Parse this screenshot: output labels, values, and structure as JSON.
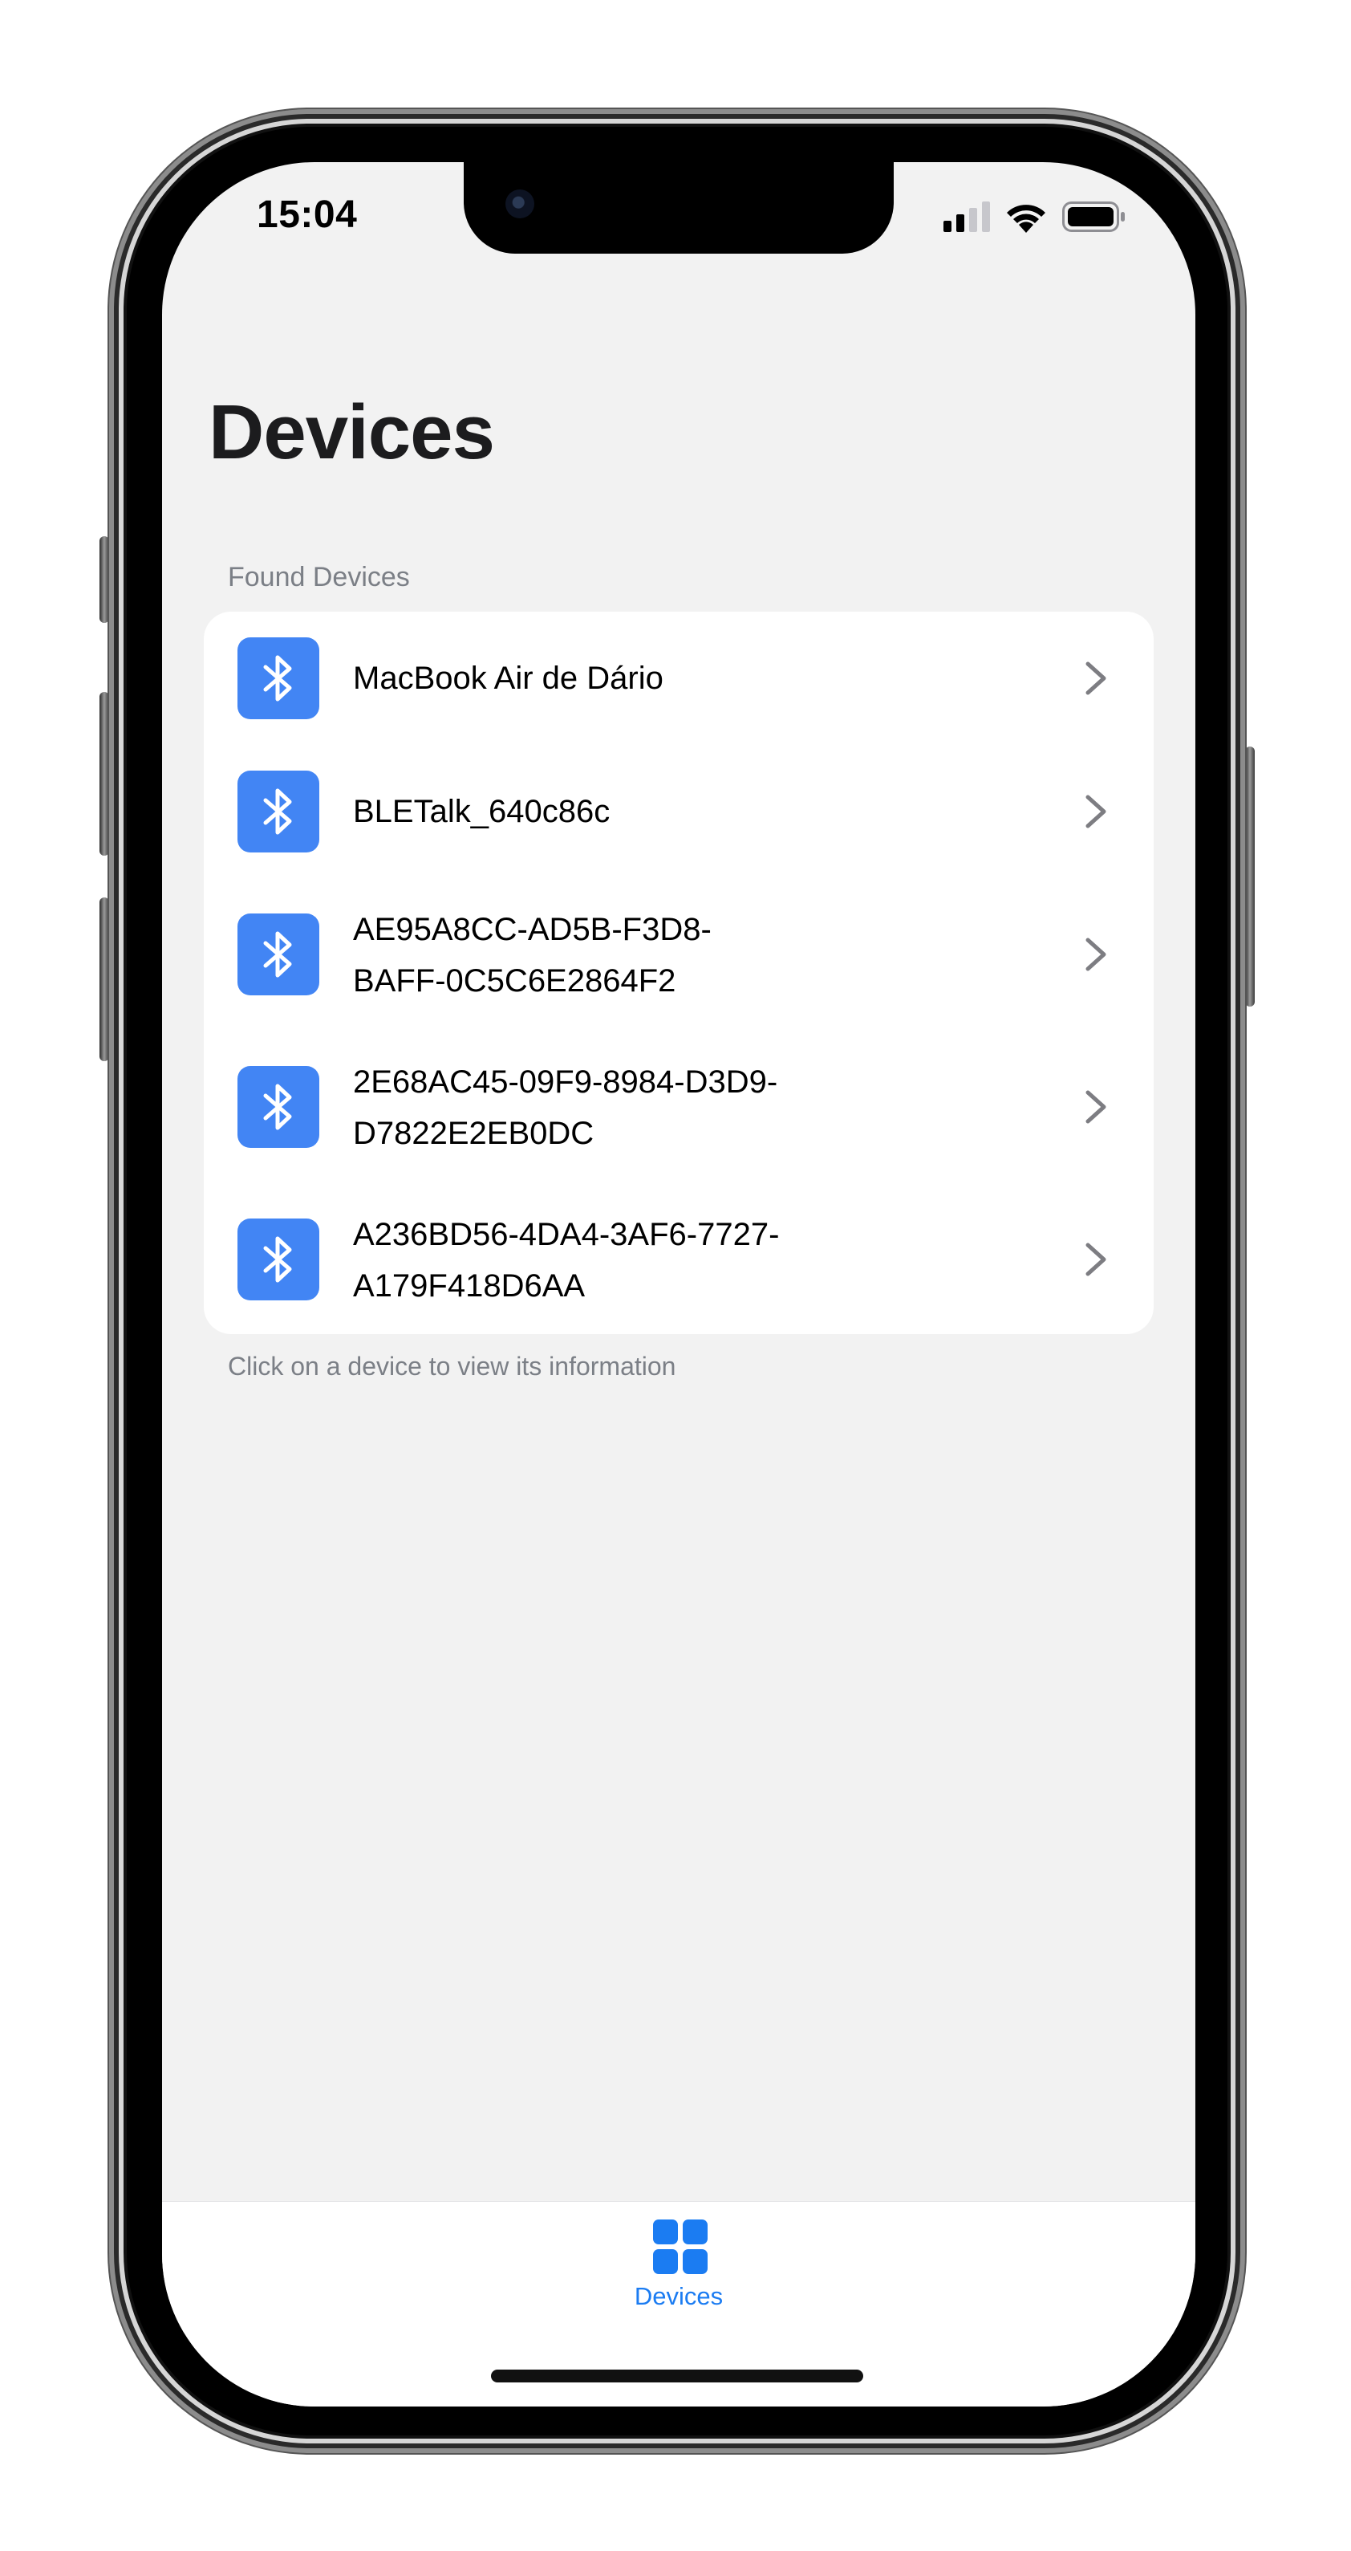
{
  "status_bar": {
    "time": "15:04",
    "icons": [
      "cellular-signal-icon",
      "wifi-icon",
      "battery-icon"
    ]
  },
  "page": {
    "title": "Devices"
  },
  "found_devices": {
    "header": "Found Devices",
    "footer": "Click on a device to view its information",
    "items": [
      {
        "name": "MacBook Air de Dário",
        "icon": "bluetooth-icon"
      },
      {
        "name": "BLETalk_640c86c",
        "icon": "bluetooth-icon"
      },
      {
        "name": "AE95A8CC-AD5B-F3D8-\nBAFF-0C5C6E2864F2",
        "icon": "bluetooth-icon"
      },
      {
        "name": "2E68AC45-09F9-8984-D3D9-\nD7822E2EB0DC",
        "icon": "bluetooth-icon"
      },
      {
        "name": "A236BD56-4DA4-3AF6-7727-\nA179F418D6AA",
        "icon": "bluetooth-icon"
      }
    ]
  },
  "tab_bar": {
    "tabs": [
      {
        "label": "Devices",
        "icon": "grid-icon",
        "selected": true
      }
    ]
  },
  "colors": {
    "accent": "#1b7cf2",
    "icon_background": "#4285f4",
    "background": "#f2f2f2",
    "secondary_text": "#7b7f86"
  }
}
